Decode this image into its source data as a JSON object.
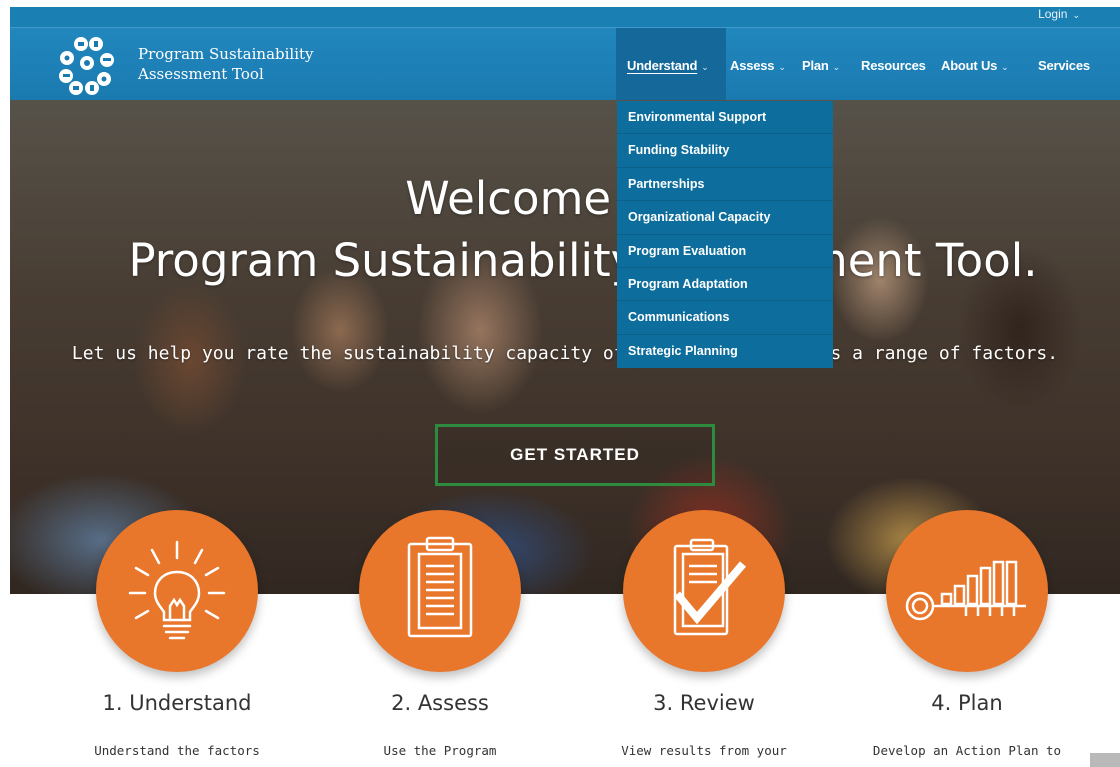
{
  "utility": {
    "login_label": "Login"
  },
  "brand": {
    "line1": "Program Sustainability",
    "line2": "Assessment Tool"
  },
  "nav": {
    "items": [
      {
        "label": "Understand",
        "has_menu": true
      },
      {
        "label": "Assess",
        "has_menu": true
      },
      {
        "label": "Plan",
        "has_menu": true
      },
      {
        "label": "Resources",
        "has_menu": false
      },
      {
        "label": "About Us",
        "has_menu": true
      },
      {
        "label": "Services",
        "has_menu": false
      }
    ],
    "active": "Understand"
  },
  "dropdown": {
    "items": [
      "Environmental Support",
      "Funding Stability",
      "Partnerships",
      "Organizational Capacity",
      "Program Evaluation",
      "Program Adaptation",
      "Communications",
      "Strategic Planning"
    ]
  },
  "hero": {
    "title_line1": "Welcome to the",
    "title_line2": "Program Sustainability Assessment Tool.",
    "subtitle": "Let us help you rate the sustainability capacity of your program across a range of factors.",
    "cta_label": "GET STARTED"
  },
  "steps": [
    {
      "title": "1. Understand",
      "desc": "Understand the factors",
      "icon": "lightbulb-icon"
    },
    {
      "title": "2. Assess",
      "desc": "Use the Program",
      "icon": "clipboard-icon"
    },
    {
      "title": "3. Review",
      "desc": "View results from your",
      "icon": "checklist-icon"
    },
    {
      "title": "4. Plan",
      "desc": "Develop an Action Plan to",
      "icon": "key-chart-icon"
    }
  ],
  "colors": {
    "header_blue": "#1a7fb3",
    "dropdown_blue": "#0d6d9c",
    "accent_orange": "#e8762b",
    "cta_green": "#2e8a3c"
  }
}
